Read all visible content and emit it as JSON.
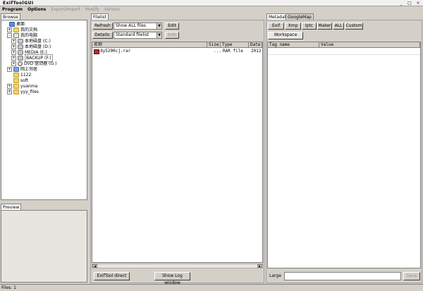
{
  "app": {
    "title": "ExifToolGUI",
    "min": "_",
    "max": "□",
    "close": "×"
  },
  "menu": [
    {
      "label": "Program",
      "enabled": true
    },
    {
      "label": "Options",
      "enabled": true
    },
    {
      "label": "Export/Import",
      "enabled": false
    },
    {
      "label": "Modify",
      "enabled": false
    },
    {
      "label": "Various",
      "enabled": false
    }
  ],
  "left": {
    "tab": "Browse",
    "tree": [
      {
        "label": "桌面",
        "exp": "",
        "icon": "desktop"
      },
      {
        "label": "我的文档",
        "exp": "+",
        "icon": "folder"
      },
      {
        "label": "我的电脑",
        "exp": "-",
        "icon": "pc"
      },
      {
        "label": "本地磁盘 (C:)",
        "exp": "+",
        "icon": "drive"
      },
      {
        "label": "本地磁盘 (D:)",
        "exp": "+",
        "icon": "drive"
      },
      {
        "label": "MEDIA (E:)",
        "exp": "+",
        "icon": "drive"
      },
      {
        "label": "BACKUP (F:)",
        "exp": "+",
        "icon": "drive"
      },
      {
        "label": "DVD 驱动器 (G:)",
        "exp": "+",
        "icon": "dvd"
      },
      {
        "label": "网上邻居",
        "exp": "+",
        "icon": "net"
      },
      {
        "label": "1122",
        "exp": "",
        "icon": "folder"
      },
      {
        "label": "soft",
        "exp": "",
        "icon": "folder"
      },
      {
        "label": "yuanma",
        "exp": "+",
        "icon": "folder"
      },
      {
        "label": "yyy_files",
        "exp": "+",
        "icon": "folder"
      }
    ],
    "preview_tab": "Preview"
  },
  "middle": {
    "tab": "Filelist",
    "refresh": "Refresh",
    "show_combo": "Show ALL files",
    "edit1": "Edit",
    "details": "Details:",
    "list_combo": "Standard filelist",
    "edit2": "Edit",
    "columns": {
      "name": "名称",
      "size": "Size",
      "type": "Type",
      "date": "Date"
    },
    "files": [
      {
        "name": "dy5200cj.rar",
        "size": "...",
        "type": "RAR file",
        "date": "2012-"
      }
    ],
    "exiftool_direct": "ExifTool direct",
    "show_log": "Show Log window"
  },
  "right": {
    "tabs": [
      "Metadata",
      "GoogleMap"
    ],
    "meta_buttons": [
      "Exif",
      "Xmp",
      "Iptc",
      "Maker",
      "ALL",
      "Custom"
    ],
    "workspace": "Workspace",
    "columns": {
      "tag": "Tag name",
      "value": "Value"
    },
    "large": "Large",
    "save": "Save"
  },
  "status": {
    "files": "Files: 1"
  }
}
